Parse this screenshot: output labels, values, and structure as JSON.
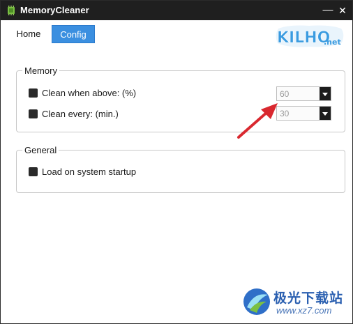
{
  "window": {
    "title": "MemoryCleaner",
    "minimize_glyph": "—",
    "close_glyph": "✕",
    "icon": "memory-chip-icon"
  },
  "tabs": [
    {
      "label": "Home",
      "selected": false
    },
    {
      "label": "Config",
      "selected": true
    }
  ],
  "logo": {
    "main": "KILHO",
    "suffix": ".net"
  },
  "memory": {
    "legend": "Memory",
    "clean_above": {
      "label": "Clean when above: (%)",
      "checked": false,
      "value": "60"
    },
    "clean_every": {
      "label": "Clean every: (min.)",
      "checked": false,
      "value": "30"
    }
  },
  "general": {
    "legend": "General",
    "startup": {
      "label": "Load on system startup",
      "checked": false
    }
  },
  "watermark": {
    "title": "极光下载站",
    "url": "www.xz7.com"
  },
  "colors": {
    "accent": "#3b8fe0",
    "titlebar": "#1f1f1f",
    "logo": "#3a9be0",
    "arrow": "#d9282f",
    "watermark": "#2a5fb0"
  }
}
